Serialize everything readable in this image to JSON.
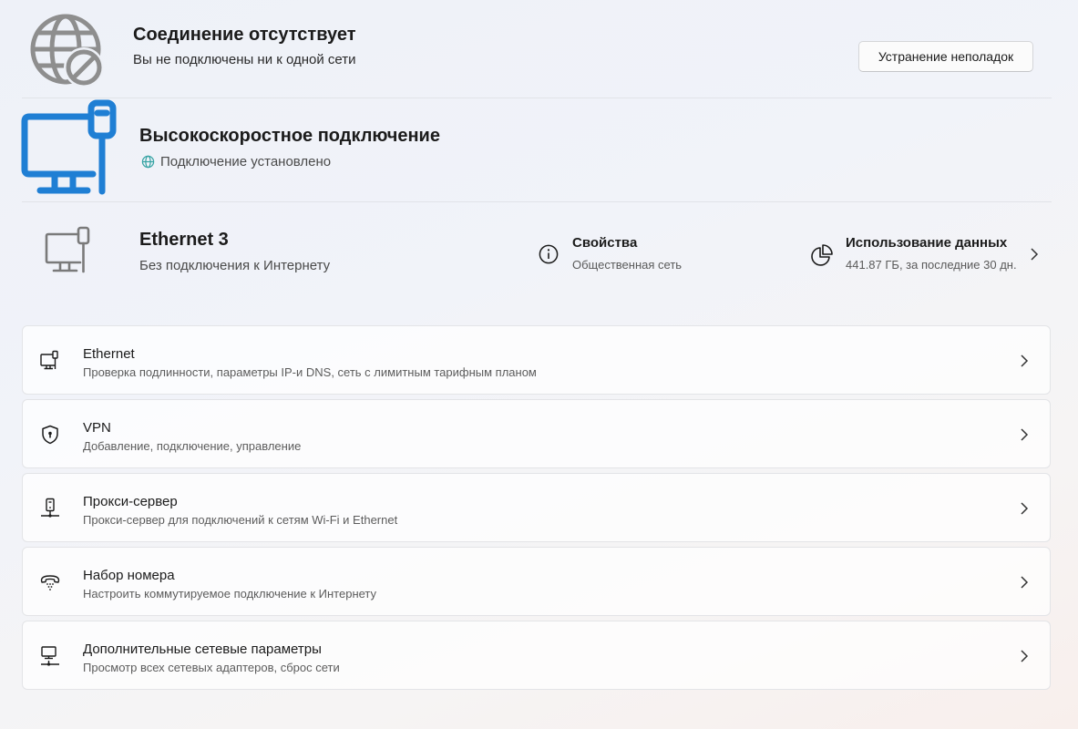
{
  "no_connection": {
    "title": "Соединение отсутствует",
    "subtitle": "Вы не подключены ни к одной сети",
    "icon": "globe-disabled-icon",
    "troubleshoot_label": "Устранение неполадок"
  },
  "high_speed": {
    "title": "Высокоскоростное подключение",
    "status": "Подключение установлено",
    "icon": "monitor-ethernet-icon",
    "accent": "#1f7fd4",
    "status_icon_color": "#35a3a3"
  },
  "ethernet3": {
    "title": "Ethernet 3",
    "subtitle": "Без подключения к Интернету",
    "properties": {
      "title": "Свойства",
      "subtitle": "Общественная сеть",
      "icon": "info-icon"
    },
    "data_usage": {
      "title": "Использование данных",
      "subtitle": "441.87 ГБ, за последние 30 дн.",
      "icon": "pie-chart-icon"
    }
  },
  "settings": [
    {
      "title": "Ethernet",
      "subtitle": "Проверка подлинности, параметры IP-и DNS, сеть с лимитным тарифным планом",
      "icon": "ethernet-icon"
    },
    {
      "title": "VPN",
      "subtitle": "Добавление, подключение, управление",
      "icon": "shield-icon"
    },
    {
      "title": "Прокси-сервер",
      "subtitle": "Прокси-сервер для подключений к сетям Wi-Fi и Ethernet",
      "icon": "proxy-server-icon"
    },
    {
      "title": "Набор номера",
      "subtitle": "Настроить коммутируемое подключение к Интернету",
      "icon": "dial-up-phone-icon"
    },
    {
      "title": "Дополнительные сетевые параметры",
      "subtitle": "Просмотр всех сетевых адаптеров, сброс сети",
      "icon": "network-adapters-icon"
    }
  ]
}
